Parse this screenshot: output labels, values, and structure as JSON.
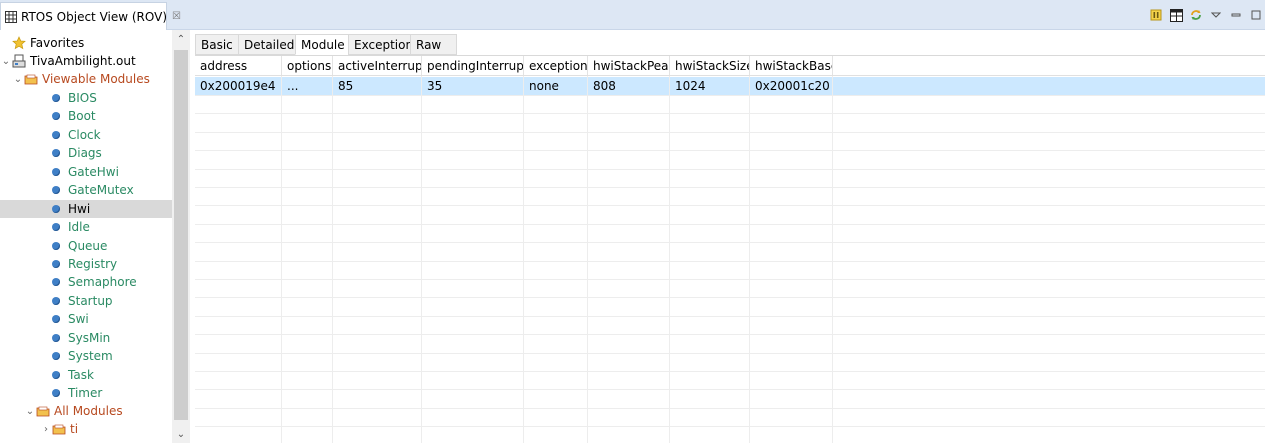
{
  "window": {
    "title": "RTOS Object View (ROV)",
    "close_glyph": "☒"
  },
  "toolbar": {
    "icons": [
      "pause-icon",
      "grid-icon",
      "refresh-icon",
      "view-menu-icon",
      "minimize-icon",
      "maximize-icon"
    ]
  },
  "tree": {
    "favorites": "Favorites",
    "program": "TivaAmbilight.out",
    "viewable_modules": "Viewable Modules",
    "modules": [
      "BIOS",
      "Boot",
      "Clock",
      "Diags",
      "GateHwi",
      "GateMutex",
      "Hwi",
      "Idle",
      "Queue",
      "Registry",
      "Semaphore",
      "Startup",
      "Swi",
      "SysMin",
      "System",
      "Task",
      "Timer"
    ],
    "selected_module": "Hwi",
    "all_modules": "All Modules",
    "ti": "ti"
  },
  "tabs": [
    "Basic",
    "Detailed",
    "Module",
    "Exception",
    "Raw"
  ],
  "active_tab": "Module",
  "table": {
    "columns": [
      "address",
      "options",
      "activeInterrupt",
      "pendingInterrupt",
      "exception",
      "hwiStackPeak",
      "hwiStackSize",
      "hwiStackBase"
    ],
    "rows": [
      [
        "0x200019e4",
        "...",
        "85",
        "35",
        "none",
        "808",
        "1024",
        "0x20001c20"
      ]
    ]
  },
  "colors": {
    "titlebar": "#dde7f4",
    "selection": "#cce8ff",
    "module_text": "#2a8a63",
    "folder_text": "#b7491f",
    "module_dot": "#3f7fc6"
  }
}
